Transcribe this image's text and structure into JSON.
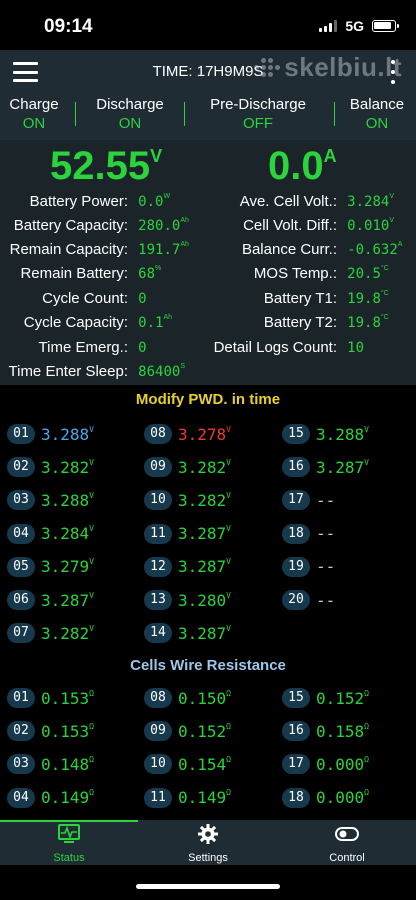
{
  "status_bar": {
    "time": "09:14",
    "network": "5G"
  },
  "header": {
    "title": "TIME: 17H9M9S",
    "watermark": "skelbiu.lt"
  },
  "switches": [
    {
      "label": "Charge",
      "value": "ON"
    },
    {
      "label": "Discharge",
      "value": "ON"
    },
    {
      "label": "Pre-Discharge",
      "value": "OFF"
    },
    {
      "label": "Balance",
      "value": "ON"
    }
  ],
  "readouts": {
    "voltage": "52.55",
    "voltage_unit": "V",
    "current": "0.0",
    "current_unit": "A"
  },
  "left_stats": [
    {
      "label": "Battery Power:",
      "value": "0.0",
      "unit": "W"
    },
    {
      "label": "Battery Capacity:",
      "value": "280.0",
      "unit": "Ah"
    },
    {
      "label": "Remain Capacity:",
      "value": "191.7",
      "unit": "Ah"
    },
    {
      "label": "Remain Battery:",
      "value": "68",
      "unit": "%"
    },
    {
      "label": "Cycle Count:",
      "value": "0",
      "unit": ""
    },
    {
      "label": "Cycle Capacity:",
      "value": "0.1",
      "unit": "Ah"
    },
    {
      "label": "Time Emerg.:",
      "value": "0",
      "unit": ""
    },
    {
      "label": "Time Enter Sleep:",
      "value": "86400",
      "unit": "S"
    }
  ],
  "right_stats": [
    {
      "label": "Ave. Cell Volt.:",
      "value": "3.284",
      "unit": "V"
    },
    {
      "label": "Cell Volt. Diff.:",
      "value": "0.010",
      "unit": "V"
    },
    {
      "label": "Balance Curr.:",
      "value": "-0.632",
      "unit": "A"
    },
    {
      "label": "MOS Temp.:",
      "value": "20.5",
      "unit": "°C"
    },
    {
      "label": "Battery T1:",
      "value": "19.8",
      "unit": "°C"
    },
    {
      "label": "Battery T2:",
      "value": "19.8",
      "unit": "°C"
    },
    {
      "label": "Detail Logs Count:",
      "value": "10",
      "unit": ""
    }
  ],
  "cells_title": "Modify PWD. in time",
  "cells": [
    {
      "id": "01",
      "value": "3.288",
      "unit": "V",
      "color": "#4aa6e8"
    },
    {
      "id": "02",
      "value": "3.282",
      "unit": "V",
      "color": "#2bd33c"
    },
    {
      "id": "03",
      "value": "3.288",
      "unit": "V",
      "color": "#2bd33c"
    },
    {
      "id": "04",
      "value": "3.284",
      "unit": "V",
      "color": "#2bd33c"
    },
    {
      "id": "05",
      "value": "3.279",
      "unit": "V",
      "color": "#2bd33c"
    },
    {
      "id": "06",
      "value": "3.287",
      "unit": "V",
      "color": "#2bd33c"
    },
    {
      "id": "07",
      "value": "3.282",
      "unit": "V",
      "color": "#2bd33c"
    },
    {
      "id": "08",
      "value": "3.278",
      "unit": "V",
      "color": "#f03a30"
    },
    {
      "id": "09",
      "value": "3.282",
      "unit": "V",
      "color": "#2bd33c"
    },
    {
      "id": "10",
      "value": "3.282",
      "unit": "V",
      "color": "#2bd33c"
    },
    {
      "id": "11",
      "value": "3.287",
      "unit": "V",
      "color": "#2bd33c"
    },
    {
      "id": "12",
      "value": "3.287",
      "unit": "V",
      "color": "#2bd33c"
    },
    {
      "id": "13",
      "value": "3.280",
      "unit": "V",
      "color": "#2bd33c"
    },
    {
      "id": "14",
      "value": "3.287",
      "unit": "V",
      "color": "#2bd33c"
    },
    {
      "id": "15",
      "value": "3.288",
      "unit": "V",
      "color": "#2bd33c"
    },
    {
      "id": "16",
      "value": "3.287",
      "unit": "V",
      "color": "#2bd33c"
    },
    {
      "id": "17",
      "value": "--",
      "unit": "",
      "color": "#c8c8c8"
    },
    {
      "id": "18",
      "value": "--",
      "unit": "",
      "color": "#c8c8c8"
    },
    {
      "id": "19",
      "value": "--",
      "unit": "",
      "color": "#c8c8c8"
    },
    {
      "id": "20",
      "value": "--",
      "unit": "",
      "color": "#c8c8c8"
    }
  ],
  "resistance_title": "Cells Wire Resistance",
  "resistances": [
    {
      "id": "01",
      "value": "0.153",
      "unit": "Ω"
    },
    {
      "id": "02",
      "value": "0.153",
      "unit": "Ω"
    },
    {
      "id": "03",
      "value": "0.148",
      "unit": "Ω"
    },
    {
      "id": "04",
      "value": "0.149",
      "unit": "Ω"
    },
    {
      "id": "08",
      "value": "0.150",
      "unit": "Ω"
    },
    {
      "id": "09",
      "value": "0.152",
      "unit": "Ω"
    },
    {
      "id": "10",
      "value": "0.154",
      "unit": "Ω"
    },
    {
      "id": "11",
      "value": "0.149",
      "unit": "Ω"
    },
    {
      "id": "15",
      "value": "0.152",
      "unit": "Ω"
    },
    {
      "id": "16",
      "value": "0.158",
      "unit": "Ω"
    },
    {
      "id": "17",
      "value": "0.000",
      "unit": "Ω"
    },
    {
      "id": "18",
      "value": "0.000",
      "unit": "Ω"
    }
  ],
  "bottom_nav": [
    {
      "label": "Status",
      "icon": "pulse-monitor-icon",
      "active": true
    },
    {
      "label": "Settings",
      "icon": "gear-icon",
      "active": false
    },
    {
      "label": "Control",
      "icon": "toggle-switch-icon",
      "active": false
    }
  ],
  "colors": {
    "accent_green": "#2bd33c",
    "warning_red": "#f03a30",
    "highlight_blue": "#4aa6e8",
    "section_yellow": "#e8d02a",
    "panel": "#1f2c34"
  }
}
